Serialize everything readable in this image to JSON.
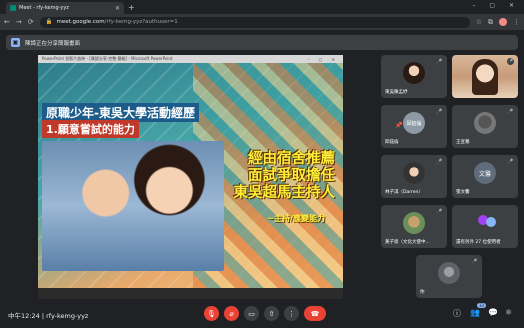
{
  "browser": {
    "tab_title": "Meet - rfy-kemg-yyz",
    "new_tab": "+",
    "window_controls": "– ▢ ✕",
    "url": "meet.google.com/rfy-kemg-yyz?authuser=1",
    "url_host": "meet.google.com",
    "url_path": "/rfy-kemg-yyz?authuser=1",
    "tab_close": "✕"
  },
  "banner": {
    "text": "陳諦正在分享簡報畫面",
    "icon": "present-icon"
  },
  "presentation": {
    "window_title": "PowerPoint 投影片放映 - [陳諦分享-完整 簡報] - Microsoft PowerPoint",
    "window_controls": "– ▢ ✕",
    "slide": {
      "heading": "原職少年-東吳大學活動經歷",
      "subheading": "1.願意嘗試的能力",
      "big_text": [
        "經由宿舍推薦",
        "面試爭取擔任",
        "東吳超馬主持人"
      ],
      "caption": "~主持/應變能力"
    }
  },
  "participants": [
    {
      "name": "東吳陳孟妤",
      "avatar": "photo"
    },
    {
      "name": "",
      "avatar": "video-woman"
    },
    {
      "name": "邱鈺倫",
      "avatar": "邱鈺倫"
    },
    {
      "name": "王宣蓁",
      "avatar": "photo"
    },
    {
      "name": "林子淇（Darren）",
      "avatar": "photo"
    },
    {
      "name": "張文馨",
      "avatar": "文馨"
    },
    {
      "name": "黃子恩（文化大使中...",
      "avatar": "photo"
    },
    {
      "name": "還有另外 27 位使用者",
      "avatar": "group"
    },
    {
      "name": "你",
      "avatar": "self"
    }
  ],
  "footer": {
    "time": "中午12:24",
    "meeting_code": "rfy-kemg-yyz",
    "separator": "|",
    "participants_count": "33"
  },
  "colors": {
    "accent": "#8ab4f8",
    "danger": "#ea4335",
    "tile": "#3c4043",
    "background": "#202124"
  }
}
